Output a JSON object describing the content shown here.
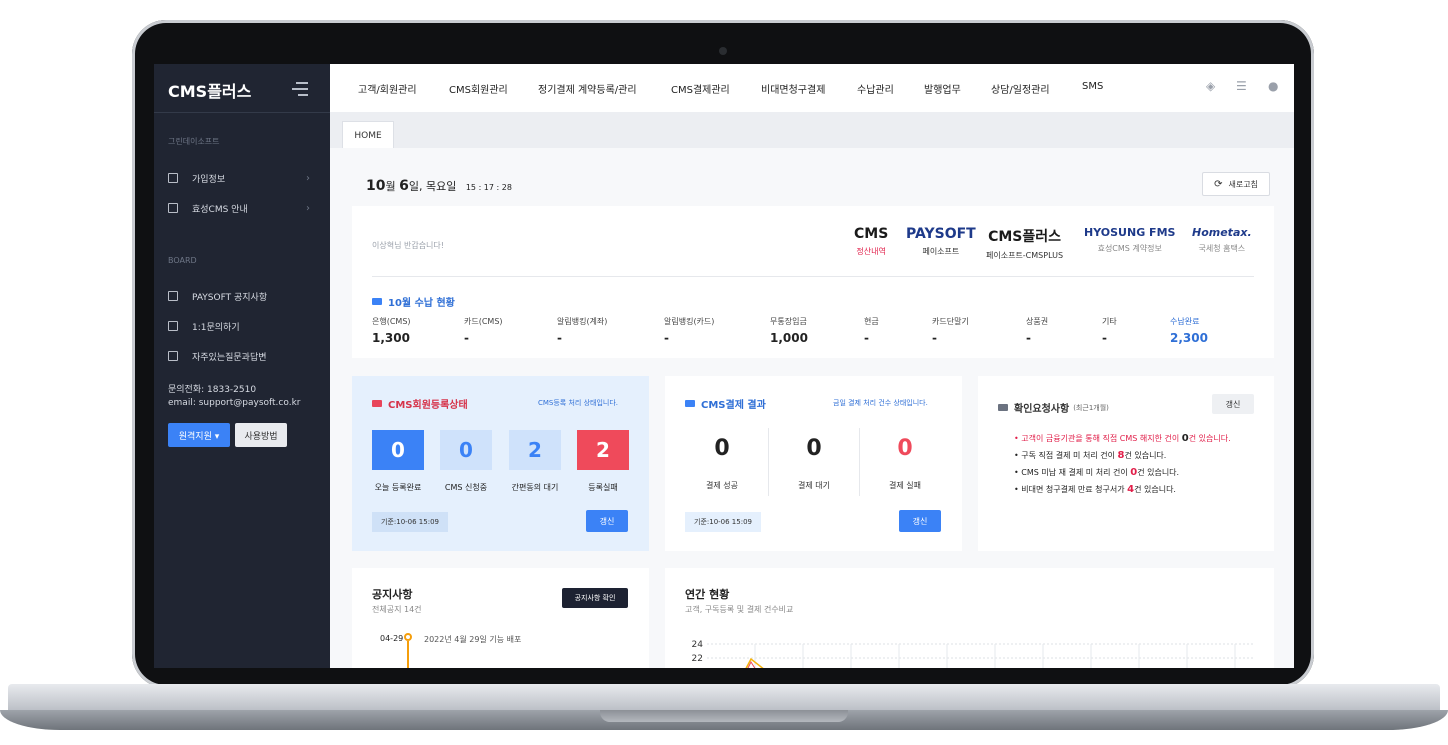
{
  "sidebar": {
    "logo": "CMS플러스",
    "company_section": "그린데이소프트",
    "items_top": [
      {
        "label": "가입정보"
      },
      {
        "label": "효성CMS 안내"
      }
    ],
    "board_section": "BOARD",
    "items_board": [
      {
        "label": "PAYSOFT 공지사항"
      },
      {
        "label": "1:1문의하기"
      },
      {
        "label": "자주있는질문과답변"
      }
    ],
    "contact_phone": "문의전화: 1833-2510",
    "contact_email": "email: support@paysoft.co.kr",
    "remote_label": "원격지원",
    "howto_label": "사용방법"
  },
  "topnav": {
    "items": [
      "고객/회원관리",
      "CMS회원관리",
      "정기결제 계약등록/관리",
      "CMS결제관리",
      "비대면청구결제",
      "수납관리",
      "발행업무",
      "상담/일정관리",
      "SMS"
    ],
    "icons": [
      "eraser-icon",
      "table-icon",
      "user-icon"
    ]
  },
  "tabs": {
    "home": "HOME"
  },
  "header": {
    "date_month": "10",
    "date_month_unit": "월",
    "date_day": "6",
    "date_day_unit": "일, 목요일",
    "time": "15 : 17 : 28",
    "refresh_label": "새로고침"
  },
  "welcome": {
    "greeting": "이상혁님 반갑습니다!",
    "partners": [
      {
        "logo": "CMS",
        "sub": "정산내역",
        "sub_color": "#e11d48"
      },
      {
        "logo": "PAYSOFT",
        "sub": "페이소프트"
      },
      {
        "logo": "CMS플러스",
        "sub": "페이소프트-CMSPLUS"
      },
      {
        "logo": "HYOSUNG FMS",
        "sub": "효성CMS 계약정보"
      },
      {
        "logo": "Hometax.",
        "sub": "국세청 홈택스"
      }
    ]
  },
  "collection": {
    "title": "10월 수납 현황",
    "metrics": [
      {
        "label": "은행(CMS)",
        "value": "1,300"
      },
      {
        "label": "카드(CMS)",
        "value": "-"
      },
      {
        "label": "알림뱅킹(계좌)",
        "value": "-"
      },
      {
        "label": "알림뱅킹(카드)",
        "value": "-"
      },
      {
        "label": "무통장입금",
        "value": "1,000"
      },
      {
        "label": "현금",
        "value": "-"
      },
      {
        "label": "카드단말기",
        "value": "-"
      },
      {
        "label": "상품권",
        "value": "-"
      },
      {
        "label": "기타",
        "value": "-"
      },
      {
        "label": "수납완료",
        "value": "2,300"
      }
    ]
  },
  "registration": {
    "title": "CMS회원등록상태",
    "subtitle": "CMS등록 처리 상태입니다.",
    "stats": [
      {
        "value": "0",
        "label": "오늘 등록완료",
        "bg": "#3b82f6",
        "fg": "#ffffff"
      },
      {
        "value": "0",
        "label": "CMS 신청중",
        "bg": "#cfe2fb",
        "fg": "#3b82f6"
      },
      {
        "value": "2",
        "label": "간편동의 대기",
        "bg": "#cfe2fb",
        "fg": "#3b82f6"
      },
      {
        "value": "2",
        "label": "등록실패",
        "bg": "#ef4a5b",
        "fg": "#ffffff"
      }
    ],
    "since": "기준:10-06 15:09",
    "refresh": "갱신"
  },
  "cms_result": {
    "title": "CMS결제 결과",
    "subtitle": "금일 결제 처리 건수 상태입니다.",
    "stats": [
      {
        "value": "0",
        "label": "결제 성공",
        "color": "#222222"
      },
      {
        "value": "0",
        "label": "결제 대기",
        "color": "#222222"
      },
      {
        "value": "0",
        "label": "결제 실패",
        "color": "#ef4a5b"
      }
    ],
    "since": "기준:10-06 15:09",
    "refresh": "갱신"
  },
  "checklist": {
    "title": "확인요청사항",
    "period": "(최근1개월)",
    "refresh": "갱신",
    "items": [
      {
        "pre": "고객이 금융기관을 통해 직접 CMS 해지한 건이 ",
        "count": "0",
        "post": "건 있습니다.",
        "highlight": true
      },
      {
        "pre": "구독 직접 결제 미 처리 건이 ",
        "count": "8",
        "post": "건 있습니다.",
        "highlight": false
      },
      {
        "pre": "CMS 미납 재 결제 미 처리 건이 ",
        "count": "0",
        "post": "건 있습니다.",
        "highlight": false
      },
      {
        "pre": "비대면 청구결제 만료 청구서가 ",
        "count": "4",
        "post": "건 있습니다.",
        "highlight": false
      }
    ]
  },
  "notice": {
    "title": "공지사항",
    "count": "전체공지 14건",
    "button": "공지사항 확인",
    "latest_date": "04-29",
    "latest_text": "2022년 4월 29일 기능 배포"
  },
  "annual": {
    "title": "연간 현황",
    "subtitle": "고객, 구독등록 및 결제 건수비교",
    "chart_data": {
      "type": "line",
      "y_ticks": [
        "24",
        "22"
      ]
    }
  }
}
